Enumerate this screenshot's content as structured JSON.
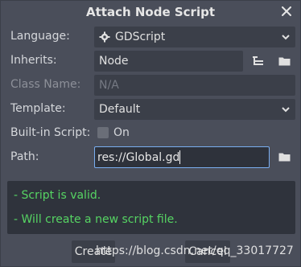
{
  "dialog": {
    "title": "Attach Node Script",
    "close_icon": "close-icon"
  },
  "form": {
    "language": {
      "label": "Language:",
      "value": "GDScript",
      "icon": "gear-icon"
    },
    "inherits": {
      "label": "Inherits:",
      "value": "Node"
    },
    "class_name": {
      "label": "Class Name:",
      "placeholder": "N/A"
    },
    "template": {
      "label": "Template:",
      "value": "Default"
    },
    "builtin": {
      "label": "Built-in Script:",
      "checkbox_label": "On",
      "checked": false
    },
    "path": {
      "label": "Path:",
      "value": "res://Global.gd"
    }
  },
  "status": {
    "line1": "- Script is valid.",
    "line2": "- Will create a new script file."
  },
  "buttons": {
    "create": "Create",
    "cancel": "Cancel"
  },
  "watermark": "https://blog.csdn.net/qq_33017727",
  "colors": {
    "background": "#4a4e5a",
    "field": "#3b3f49",
    "accent": "#7aaef0",
    "valid_text": "#56d463"
  }
}
